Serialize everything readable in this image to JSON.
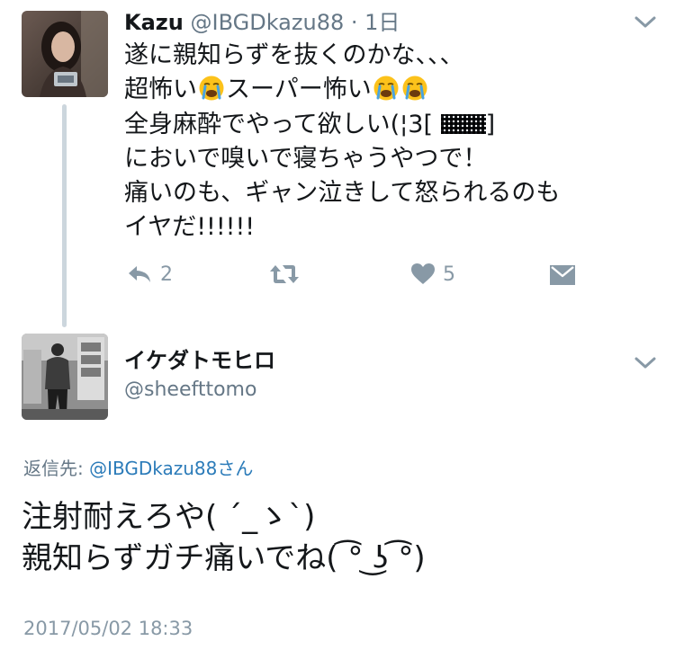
{
  "tweet1": {
    "display_name": "Kazu",
    "handle": "@IBGDkazu88",
    "separator": " · ",
    "time_ago": "1日",
    "lines": {
      "l1": "遂に親知らずを抜くのかな、、、",
      "l2a": "超怖い",
      "l2b": "スーパー怖い",
      "l3a": "全身麻酔でやって欲しい(¦3[",
      "l3b": "]",
      "l4": "においで嗅いで寝ちゃうやつで！",
      "l5": "痛いのも、ギャン泣きして怒られるのも",
      "l6": "イヤだ!!!!!!"
    },
    "emoji": "loudly-crying-face",
    "actions": {
      "reply_count": "2",
      "like_count": "5"
    }
  },
  "tweet2": {
    "display_name": "イケダトモヒロ",
    "handle": "@sheefttomo",
    "replying_label": "返信先: ",
    "replying_mention": "@IBGDkazu88さん",
    "lines": {
      "l1": "注射耐えろや( ´_ゝ`)",
      "l2": "親知らずガチ痛いでね( ͡° ͜ʖ ͡°)"
    },
    "timestamp": "2017/05/02 18:33"
  },
  "colors": {
    "text": "#14171a",
    "muted": "#657786",
    "icon": "#8899a6",
    "link": "#2b7bb9",
    "thread_line": "#ccd6dd"
  }
}
